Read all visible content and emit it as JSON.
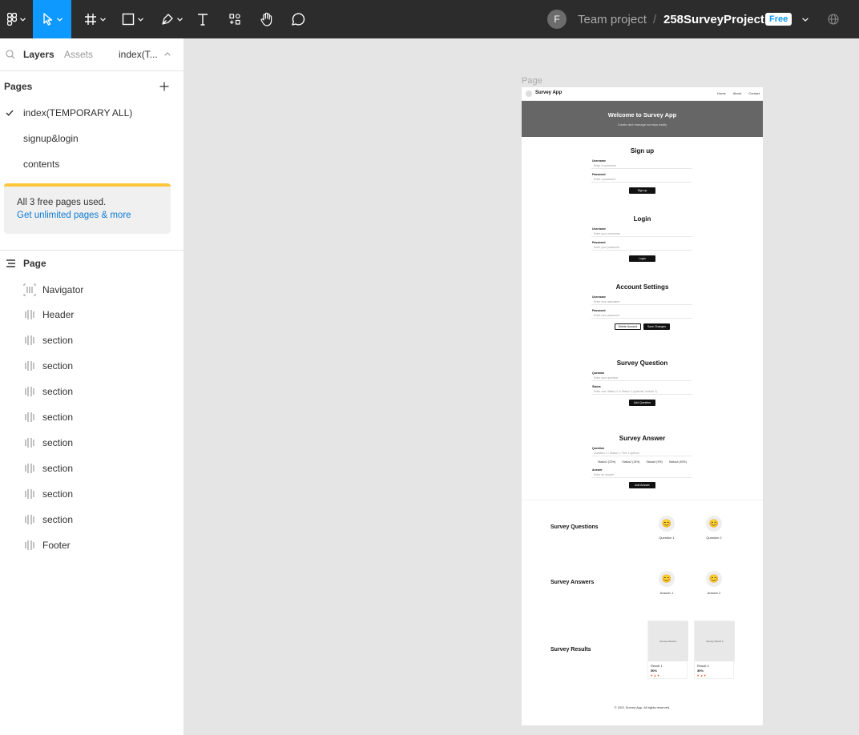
{
  "toolbar": {
    "team": "Team project",
    "separator": "/",
    "project": "258SurveyProject",
    "plan_badge": "Free",
    "avatar_initial": "F",
    "active_tool": "move",
    "accent": "#0d99ff"
  },
  "panel": {
    "tabs": {
      "layers": "Layers",
      "assets": "Assets",
      "page_picker": "index(T..."
    },
    "pages_heading": "Pages",
    "pages": [
      {
        "label": "index(TEMPORARY ALL)",
        "current": true
      },
      {
        "label": "signup&login",
        "current": false
      },
      {
        "label": "contents",
        "current": false
      }
    ],
    "notice": {
      "text": "All 3 free pages used.",
      "link": "Get unlimited pages & more"
    },
    "layers_root": "Page",
    "layers": [
      {
        "label": "Navigator",
        "icon": "frame-icon"
      },
      {
        "label": "Header",
        "icon": "auto-layout-icon"
      },
      {
        "label": "section",
        "icon": "auto-layout-icon"
      },
      {
        "label": "section",
        "icon": "auto-layout-icon"
      },
      {
        "label": "section",
        "icon": "auto-layout-icon"
      },
      {
        "label": "section",
        "icon": "auto-layout-icon"
      },
      {
        "label": "section",
        "icon": "auto-layout-icon"
      },
      {
        "label": "section",
        "icon": "auto-layout-icon"
      },
      {
        "label": "section",
        "icon": "auto-layout-icon"
      },
      {
        "label": "section",
        "icon": "auto-layout-icon"
      },
      {
        "label": "Footer",
        "icon": "auto-layout-icon"
      }
    ]
  },
  "canvas": {
    "frame_label": "Page",
    "nav": {
      "brand": "Survey App",
      "links": [
        "Home",
        "About",
        "Contact"
      ]
    },
    "hero": {
      "title": "Welcome to Survey App",
      "subtitle": "Create and manage surveys easily"
    },
    "signup": {
      "title": "Sign up",
      "username_label": "Username",
      "username_ph": "Enter a username",
      "password_label": "Password",
      "password_ph": "Enter a password",
      "button": "Sign up"
    },
    "login": {
      "title": "Login",
      "username_label": "Username",
      "username_ph": "Enter your username",
      "password_label": "Password",
      "password_ph": "Enter your password",
      "button": "Login"
    },
    "account": {
      "title": "Account Settings",
      "username_label": "Username",
      "username_ph": "Enter new username",
      "password_label": "Password",
      "password_ph": "Enter new password",
      "delete_button": "Delete Account",
      "save_button": "Save Changes"
    },
    "question": {
      "title": "Survey Question",
      "question_label": "Question",
      "question_ph": "Enter your question",
      "status_label": "Status",
      "status_ph": "Enter one: Status 1 or Status 2 (optional, include 1)",
      "button": "Add Question"
    },
    "answer": {
      "title": "Survey Answer",
      "question_label": "Question",
      "question_ph": "Question 1 / Status 1 / Tier 1 options",
      "options": [
        "Status1 (23%)",
        "Status2 (15%)",
        "Status3 (9%)",
        "Status4 (53%)"
      ],
      "answer_label": "Answer",
      "answer_ph": "Enter an answer",
      "button": "Add Answer"
    },
    "questions_section": {
      "title": "Survey Questions",
      "items": [
        "Question 1",
        "Question 2"
      ]
    },
    "answers_section": {
      "title": "Survey Answers",
      "items": [
        "Answer 1",
        "Answer 2"
      ]
    },
    "results_section": {
      "title": "Survey Results",
      "cards": [
        {
          "image_text": "Survey Result 1",
          "title": "Result 1",
          "percent": "50%",
          "reactions": "♥ ▲ ♥"
        },
        {
          "image_text": "Survey Result 2",
          "title": "Result 2",
          "percent": "30%",
          "reactions": "♥ ▲ ♥"
        }
      ]
    },
    "footer": "© 2021 Survey App. All rights reserved.",
    "emoji": "😊"
  }
}
